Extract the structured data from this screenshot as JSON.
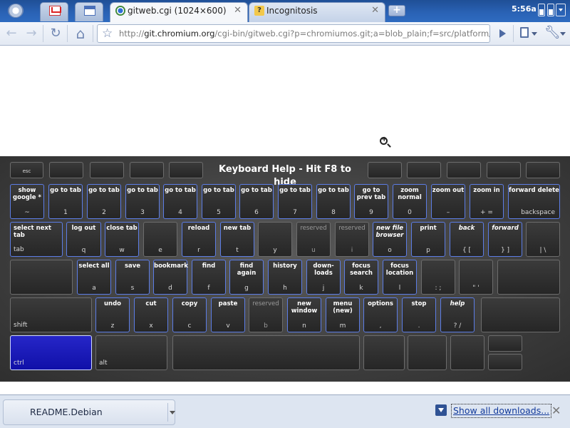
{
  "tabs": {
    "pinned": [
      {
        "name": "gmail"
      },
      {
        "name": "calendar"
      }
    ],
    "active": {
      "title": "gitweb.cgi (1024×600)"
    },
    "inactive": {
      "title": "Incognitosis"
    },
    "new_tab_label": "+"
  },
  "system": {
    "clock": "5:56a"
  },
  "toolbar": {
    "back_icon": "←",
    "forward_icon": "→",
    "reload_icon": "↻",
    "home_icon": "⌂",
    "bookmark_star": "☆",
    "url_scheme": "http://",
    "url_host": "git.chromium.org",
    "url_path": "/cgi-bin/gitweb.cgi?p=chromiumos.git;a=blob_plain;f=src/platform/assets",
    "wrench_icon": "🔧"
  },
  "keyboard": {
    "title": "Keyboard Help - Hit F8 to hide",
    "row1": [
      {
        "action": "show google *",
        "glyph": "~"
      },
      {
        "action": "go to tab",
        "glyph": "1"
      },
      {
        "action": "go to tab",
        "glyph": "2"
      },
      {
        "action": "go to tab",
        "glyph": "3"
      },
      {
        "action": "go to tab",
        "glyph": "4"
      },
      {
        "action": "go to tab",
        "glyph": "5"
      },
      {
        "action": "go to tab",
        "glyph": "6"
      },
      {
        "action": "go to tab",
        "glyph": "7"
      },
      {
        "action": "go to tab",
        "glyph": "8"
      },
      {
        "action": "go to prev tab",
        "glyph": "9"
      },
      {
        "action": "zoom normal",
        "glyph": "0"
      },
      {
        "action": "zoom out",
        "glyph": "–"
      },
      {
        "action": "zoom in",
        "glyph": "+ ="
      },
      {
        "action": "forward delete",
        "glyph": "backspace"
      }
    ],
    "row2": [
      {
        "action": "select next tab",
        "glyph": "tab"
      },
      {
        "action": "log out",
        "glyph": "q"
      },
      {
        "action": "close tab",
        "glyph": "w"
      },
      {
        "action": "",
        "glyph": "e"
      },
      {
        "action": "reload",
        "glyph": "r"
      },
      {
        "action": "new tab",
        "glyph": "t"
      },
      {
        "action": "",
        "glyph": "y"
      },
      {
        "action": "reserved",
        "glyph": "u"
      },
      {
        "action": "reserved",
        "glyph": "i"
      },
      {
        "action": "new file browser",
        "glyph": "o"
      },
      {
        "action": "print",
        "glyph": "p"
      },
      {
        "action": "back",
        "glyph": "{ ["
      },
      {
        "action": "forward",
        "glyph": "} ]"
      },
      {
        "action": "",
        "glyph": "| \\"
      }
    ],
    "row3": [
      {
        "action": "",
        "glyph": ""
      },
      {
        "action": "select all",
        "glyph": "a"
      },
      {
        "action": "save",
        "glyph": "s"
      },
      {
        "action": "bookmark",
        "glyph": "d"
      },
      {
        "action": "find",
        "glyph": "f"
      },
      {
        "action": "find again",
        "glyph": "g"
      },
      {
        "action": "history",
        "glyph": "h"
      },
      {
        "action": "down-loads",
        "glyph": "j"
      },
      {
        "action": "focus search",
        "glyph": "k"
      },
      {
        "action": "focus location",
        "glyph": "l"
      },
      {
        "action": "",
        "glyph": ": ;"
      },
      {
        "action": "",
        "glyph": "\" '"
      },
      {
        "action": "",
        "glyph": ""
      }
    ],
    "row4": [
      {
        "action": "",
        "glyph": "shift"
      },
      {
        "action": "undo",
        "glyph": "z"
      },
      {
        "action": "cut",
        "glyph": "x"
      },
      {
        "action": "copy",
        "glyph": "c"
      },
      {
        "action": "paste",
        "glyph": "v"
      },
      {
        "action": "reserved",
        "glyph": "b"
      },
      {
        "action": "new window",
        "glyph": "n"
      },
      {
        "action": "menu (new)",
        "glyph": "m"
      },
      {
        "action": "options",
        "glyph": ","
      },
      {
        "action": "stop",
        "glyph": "."
      },
      {
        "action": "help",
        "glyph": "? /"
      },
      {
        "action": "",
        "glyph": ""
      }
    ],
    "row5": [
      {
        "action": "",
        "glyph": "ctrl"
      },
      {
        "action": "",
        "glyph": "alt"
      },
      {
        "action": "",
        "glyph": ""
      },
      {
        "action": "",
        "glyph": ""
      },
      {
        "action": "",
        "glyph": ""
      },
      {
        "action": "",
        "glyph": ""
      },
      {
        "action": "",
        "glyph": ""
      },
      {
        "action": "",
        "glyph": ""
      }
    ]
  },
  "download_shelf": {
    "item_name": "README.Debian",
    "show_all_label": "Show all downloads...",
    "close_icon": "✕"
  },
  "colors": {
    "tabstrip": "#2a63b6",
    "key_highlight": "#5c7de6",
    "ctrl_active": "#1a1ab8",
    "link": "#123a9b"
  }
}
